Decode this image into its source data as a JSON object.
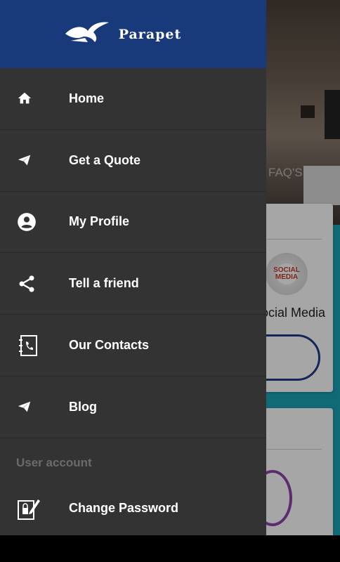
{
  "app": {
    "brand_name": "Parapet"
  },
  "background": {
    "faq_label": "FAQ'S",
    "card1_logo_text": "SOCIAL MEDIA",
    "card1_title": "Social Media"
  },
  "drawer": {
    "items": [
      {
        "label": "Home",
        "icon": "home-icon"
      },
      {
        "label": "Get a Quote",
        "icon": "send-icon"
      },
      {
        "label": "My Profile",
        "icon": "account-circle-icon"
      },
      {
        "label": "Tell a friend",
        "icon": "share-icon"
      },
      {
        "label": "Our Contacts",
        "icon": "contacts-book-icon"
      },
      {
        "label": "Blog",
        "icon": "send-icon"
      }
    ],
    "section_label": "User account",
    "account_items": [
      {
        "label": "Change Password",
        "icon": "edit-lock-icon"
      }
    ]
  },
  "colors": {
    "header": "#193a7a",
    "drawer_bg": "#333333",
    "section_text": "#6b6b6b"
  }
}
